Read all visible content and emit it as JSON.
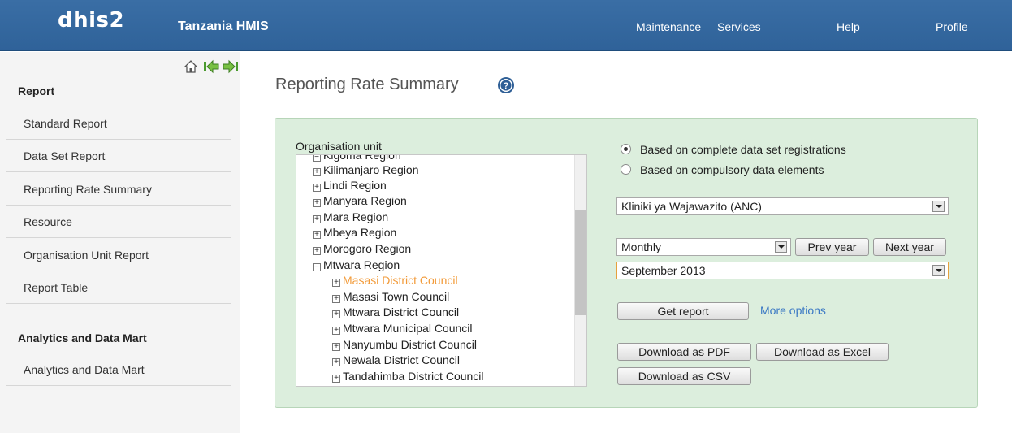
{
  "topbar": {
    "logo": "dhis2",
    "app_name": "Tanzania HMIS",
    "menu": [
      "Maintenance",
      "Services",
      "Help",
      "Profile"
    ]
  },
  "sidebar": {
    "sections": [
      {
        "title": "Report",
        "items": [
          "Standard Report",
          "Data Set Report",
          "Reporting Rate Summary",
          "Resource",
          "Organisation Unit Report",
          "Report Table"
        ]
      },
      {
        "title": "Analytics and Data Mart",
        "items": [
          "Analytics and Data Mart"
        ]
      }
    ]
  },
  "page": {
    "title": "Reporting Rate Summary"
  },
  "form": {
    "org_unit_label": "Organisation unit",
    "tree": [
      {
        "label": "Kigoma Region",
        "expanded": true,
        "level": 0,
        "partial": true
      },
      {
        "label": "Kilimanjaro Region",
        "expanded": false,
        "level": 0
      },
      {
        "label": "Lindi Region",
        "expanded": false,
        "level": 0
      },
      {
        "label": "Manyara Region",
        "expanded": false,
        "level": 0
      },
      {
        "label": "Mara Region",
        "expanded": false,
        "level": 0
      },
      {
        "label": "Mbeya Region",
        "expanded": false,
        "level": 0
      },
      {
        "label": "Morogoro Region",
        "expanded": false,
        "level": 0
      },
      {
        "label": "Mtwara Region",
        "expanded": true,
        "level": 0
      },
      {
        "label": "Masasi District Council",
        "expanded": false,
        "level": 1,
        "selected": true
      },
      {
        "label": "Masasi Town Council",
        "expanded": false,
        "level": 1
      },
      {
        "label": "Mtwara District Council",
        "expanded": false,
        "level": 1
      },
      {
        "label": "Mtwara Municipal Council",
        "expanded": false,
        "level": 1
      },
      {
        "label": "Nanyumbu District Council",
        "expanded": false,
        "level": 1
      },
      {
        "label": "Newala District Council",
        "expanded": false,
        "level": 1
      },
      {
        "label": "Tandahimba District Council",
        "expanded": false,
        "level": 1
      }
    ],
    "radio_complete": "Based on complete data set registrations",
    "radio_compulsory": "Based on compulsory data elements",
    "selected_radio": "complete",
    "data_set": "Kliniki ya Wajawazito (ANC)",
    "period_type": "Monthly",
    "prev_year": "Prev year",
    "next_year": "Next year",
    "period": "September 2013",
    "get_report": "Get report",
    "more_options": "More options",
    "download_pdf": "Download as PDF",
    "download_excel": "Download as Excel",
    "download_csv": "Download as CSV"
  },
  "colors": {
    "header": "#3a6ea5",
    "panel": "#dceedd",
    "selected_node": "#f29a38",
    "link": "#3a78c4"
  }
}
